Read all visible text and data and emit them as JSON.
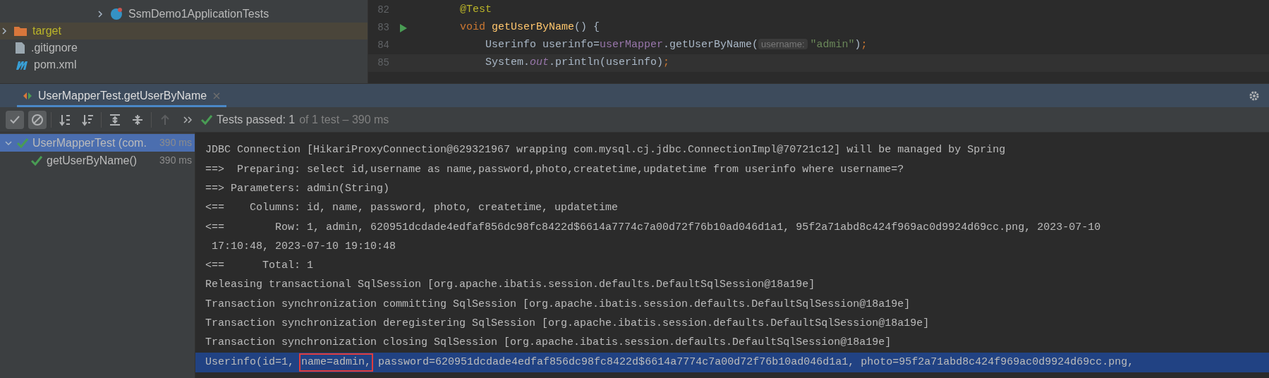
{
  "project_tree": {
    "items": [
      {
        "label": "SsmDemo1ApplicationTests",
        "kind": "test-class",
        "expanded": false,
        "selected": false
      },
      {
        "label": "target",
        "kind": "folder",
        "expanded": false,
        "selected": true
      },
      {
        "label": ".gitignore",
        "kind": "ignore-file",
        "selected": false
      },
      {
        "label": "pom.xml",
        "kind": "maven",
        "selected": false
      }
    ]
  },
  "editor": {
    "lines": [
      {
        "number": "82",
        "current": false,
        "runnable": false,
        "tokens": [
          {
            "kind": "annotation",
            "text": "@Test"
          }
        ]
      },
      {
        "number": "83",
        "current": false,
        "runnable": true,
        "tokens": [
          {
            "kind": "keyword",
            "text": "void "
          },
          {
            "kind": "method",
            "text": "getUserByName"
          },
          {
            "kind": "plain",
            "text": "() {"
          }
        ]
      },
      {
        "number": "84",
        "current": false,
        "runnable": false,
        "tokens": [
          {
            "kind": "plain",
            "text": "    Userinfo userinfo="
          },
          {
            "kind": "field",
            "text": "userMapper"
          },
          {
            "kind": "plain",
            "text": ".getUserByName("
          },
          {
            "kind": "hint",
            "text": "username:"
          },
          {
            "kind": "string",
            "text": "\"admin\""
          },
          {
            "kind": "plain",
            "text": ")"
          },
          {
            "kind": "keyword",
            "text": ";"
          }
        ]
      },
      {
        "number": "85",
        "current": true,
        "runnable": false,
        "tokens": [
          {
            "kind": "plain",
            "text": "    System."
          },
          {
            "kind": "static",
            "text": "out"
          },
          {
            "kind": "plain",
            "text": ".println(userinfo)"
          },
          {
            "kind": "keyword",
            "text": ";"
          }
        ]
      }
    ]
  },
  "run_window": {
    "tab": {
      "label": "UserMapperTest.getUserByName",
      "selected": true
    },
    "toolbar": [
      {
        "kind": "check",
        "on": true,
        "disabled": false
      },
      {
        "kind": "ignored",
        "on": true,
        "disabled": false
      },
      {
        "kind": "sort-alpha",
        "on": false,
        "disabled": false
      },
      {
        "kind": "sort-duration",
        "on": false,
        "disabled": false
      },
      {
        "kind": "expand",
        "on": false,
        "disabled": false
      },
      {
        "kind": "collapse",
        "on": false,
        "disabled": false
      },
      {
        "kind": "up",
        "on": false,
        "disabled": true
      },
      {
        "kind": "more",
        "on": false,
        "disabled": false
      }
    ],
    "status": {
      "main": "Tests passed: 1",
      "detail": "of 1 test – 390 ms"
    },
    "tests": [
      {
        "label": "UserMapperTest (com.",
        "time": "390 ms",
        "passed": true,
        "selected": true,
        "expanded": true,
        "children": [
          {
            "label": "getUserByName()",
            "time": "390 ms",
            "passed": true,
            "selected": false
          }
        ]
      }
    ],
    "console": [
      {
        "selected": false,
        "segments": [
          {
            "text": "JDBC Connection [HikariProxyConnection@629321967 wrapping com.mysql.cj.jdbc.ConnectionImpl@70721c12] will be managed by Spring",
            "boxed": false
          }
        ]
      },
      {
        "selected": false,
        "segments": [
          {
            "text": "==>  Preparing: select id,username as name,password,photo,createtime,updatetime from userinfo where username=?",
            "boxed": false
          }
        ]
      },
      {
        "selected": false,
        "segments": [
          {
            "text": "==> Parameters: admin(String)",
            "boxed": false
          }
        ]
      },
      {
        "selected": false,
        "segments": [
          {
            "text": "<==    Columns: id, name, password, photo, createtime, updatetime",
            "boxed": false
          }
        ]
      },
      {
        "selected": false,
        "segments": [
          {
            "text": "<==        Row: 1, admin, 620951dcdade4edfaf856dc98fc8422d$6614a7774c7a00d72f76b10ad046d1a1, 95f2a71abd8c424f969ac0d9924d69cc.png, 2023-07-10",
            "boxed": false
          }
        ]
      },
      {
        "selected": false,
        "segments": [
          {
            "text": " 17:10:48, 2023-07-10 19:10:48",
            "boxed": false
          }
        ]
      },
      {
        "selected": false,
        "segments": [
          {
            "text": "<==      Total: 1",
            "boxed": false
          }
        ]
      },
      {
        "selected": false,
        "segments": [
          {
            "text": "Releasing transactional SqlSession [org.apache.ibatis.session.defaults.DefaultSqlSession@18a19e]",
            "boxed": false
          }
        ]
      },
      {
        "selected": false,
        "segments": [
          {
            "text": "Transaction synchronization committing SqlSession [org.apache.ibatis.session.defaults.DefaultSqlSession@18a19e]",
            "boxed": false
          }
        ]
      },
      {
        "selected": false,
        "segments": [
          {
            "text": "Transaction synchronization deregistering SqlSession [org.apache.ibatis.session.defaults.DefaultSqlSession@18a19e]",
            "boxed": false
          }
        ]
      },
      {
        "selected": false,
        "segments": [
          {
            "text": "Transaction synchronization closing SqlSession [org.apache.ibatis.session.defaults.DefaultSqlSession@18a19e]",
            "boxed": false
          }
        ]
      },
      {
        "selected": true,
        "segments": [
          {
            "text": "Userinfo(id=1, ",
            "boxed": false
          },
          {
            "text": "name=admin,",
            "boxed": true
          },
          {
            "text": " password=620951dcdade4edfaf856dc98fc8422d$6614a7774c7a00d72f76b10ad046d1a1, photo=95f2a71abd8c424f969ac0d9924d69cc.png,",
            "boxed": false
          }
        ]
      }
    ]
  }
}
